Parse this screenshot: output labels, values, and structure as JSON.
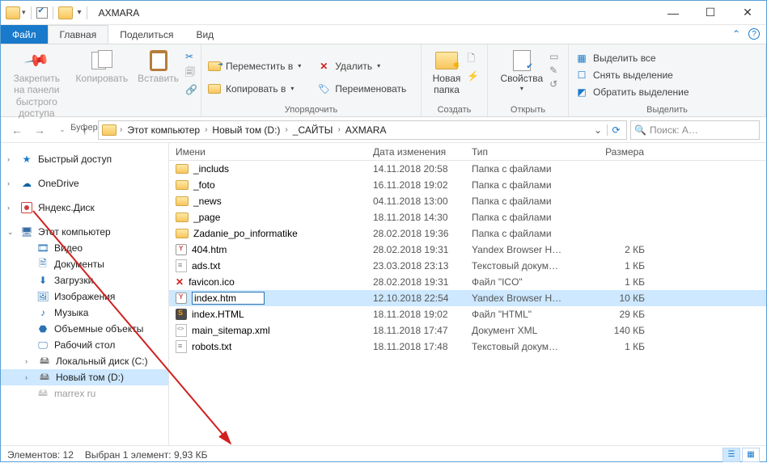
{
  "window": {
    "title": "AXMARA"
  },
  "tabs": {
    "file": "Файл",
    "home": "Главная",
    "share": "Поделиться",
    "view": "Вид"
  },
  "ribbon": {
    "clipboard": {
      "pin": "Закрепить на панели\nбыстрого доступа",
      "copy": "Копировать",
      "paste": "Вставить",
      "group": "Буфер обмена"
    },
    "organize": {
      "moveTo": "Переместить в",
      "copyTo": "Копировать в",
      "delete": "Удалить",
      "rename": "Переименовать",
      "group": "Упорядочить"
    },
    "new": {
      "newFolder": "Новая\nпапка",
      "group": "Создать"
    },
    "open": {
      "properties": "Свойства",
      "group": "Открыть"
    },
    "select": {
      "selectAll": "Выделить все",
      "selectNone": "Снять выделение",
      "invert": "Обратить выделение",
      "group": "Выделить"
    }
  },
  "address": {
    "segments": [
      "Этот компьютер",
      "Новый том (D:)",
      "_САЙТЫ",
      "AXMARA"
    ],
    "searchPlaceholder": "Поиск: A…"
  },
  "columns": {
    "name": "Имени",
    "date": "Дата изменения",
    "type": "Тип",
    "size": "Размера"
  },
  "sidebar": {
    "quick": "Быстрый доступ",
    "onedrive": "OneDrive",
    "yadisk": "Яндекс.Диск",
    "pc": "Этот компьютер",
    "pcChildren": {
      "video": "Видео",
      "docs": "Документы",
      "downloads": "Загрузки",
      "pictures": "Изображения",
      "music": "Музыка",
      "objects3d": "Объемные объекты",
      "desktop": "Рабочий стол",
      "cdrive": "Локальный диск (C:)",
      "ddrive": "Новый том (D:)",
      "extra": "marrex ru"
    }
  },
  "files": [
    {
      "name": "_includs",
      "date": "14.11.2018 20:58",
      "type": "Папка с файлами",
      "size": "",
      "kind": "folder"
    },
    {
      "name": "_foto",
      "date": "16.11.2018 19:02",
      "type": "Папка с файлами",
      "size": "",
      "kind": "folder"
    },
    {
      "name": "_news",
      "date": "04.11.2018 13:00",
      "type": "Папка с файлами",
      "size": "",
      "kind": "folder"
    },
    {
      "name": "_page",
      "date": "18.11.2018 14:30",
      "type": "Папка с файлами",
      "size": "",
      "kind": "folder"
    },
    {
      "name": "Zadanie_po_informatike",
      "date": "28.02.2018 19:36",
      "type": "Папка с файлами",
      "size": "",
      "kind": "folder"
    },
    {
      "name": "404.htm",
      "date": "28.02.2018 19:31",
      "type": "Yandex Browser H…",
      "size": "2 КБ",
      "kind": "yx"
    },
    {
      "name": "ads.txt",
      "date": "23.03.2018 23:13",
      "type": "Текстовый докум…",
      "size": "1 КБ",
      "kind": "txt"
    },
    {
      "name": "favicon.ico",
      "date": "28.02.2018 19:31",
      "type": "Файл \"ICO\"",
      "size": "1 КБ",
      "kind": "ico"
    },
    {
      "name": "index.htm",
      "date": "12.10.2018 22:54",
      "type": "Yandex Browser H…",
      "size": "10 КБ",
      "kind": "yx",
      "selected": true,
      "renaming": true
    },
    {
      "name": "index.HTML",
      "date": "18.11.2018 19:02",
      "type": "Файл \"HTML\"",
      "size": "29 КБ",
      "kind": "subl"
    },
    {
      "name": "main_sitemap.xml",
      "date": "18.11.2018 17:47",
      "type": "Документ XML",
      "size": "140 КБ",
      "kind": "xml"
    },
    {
      "name": "robots.txt",
      "date": "18.11.2018 17:48",
      "type": "Текстовый докум…",
      "size": "1 КБ",
      "kind": "txt"
    }
  ],
  "status": {
    "count": "Элементов: 12",
    "selection": "Выбран 1 элемент: 9,93 КБ"
  }
}
